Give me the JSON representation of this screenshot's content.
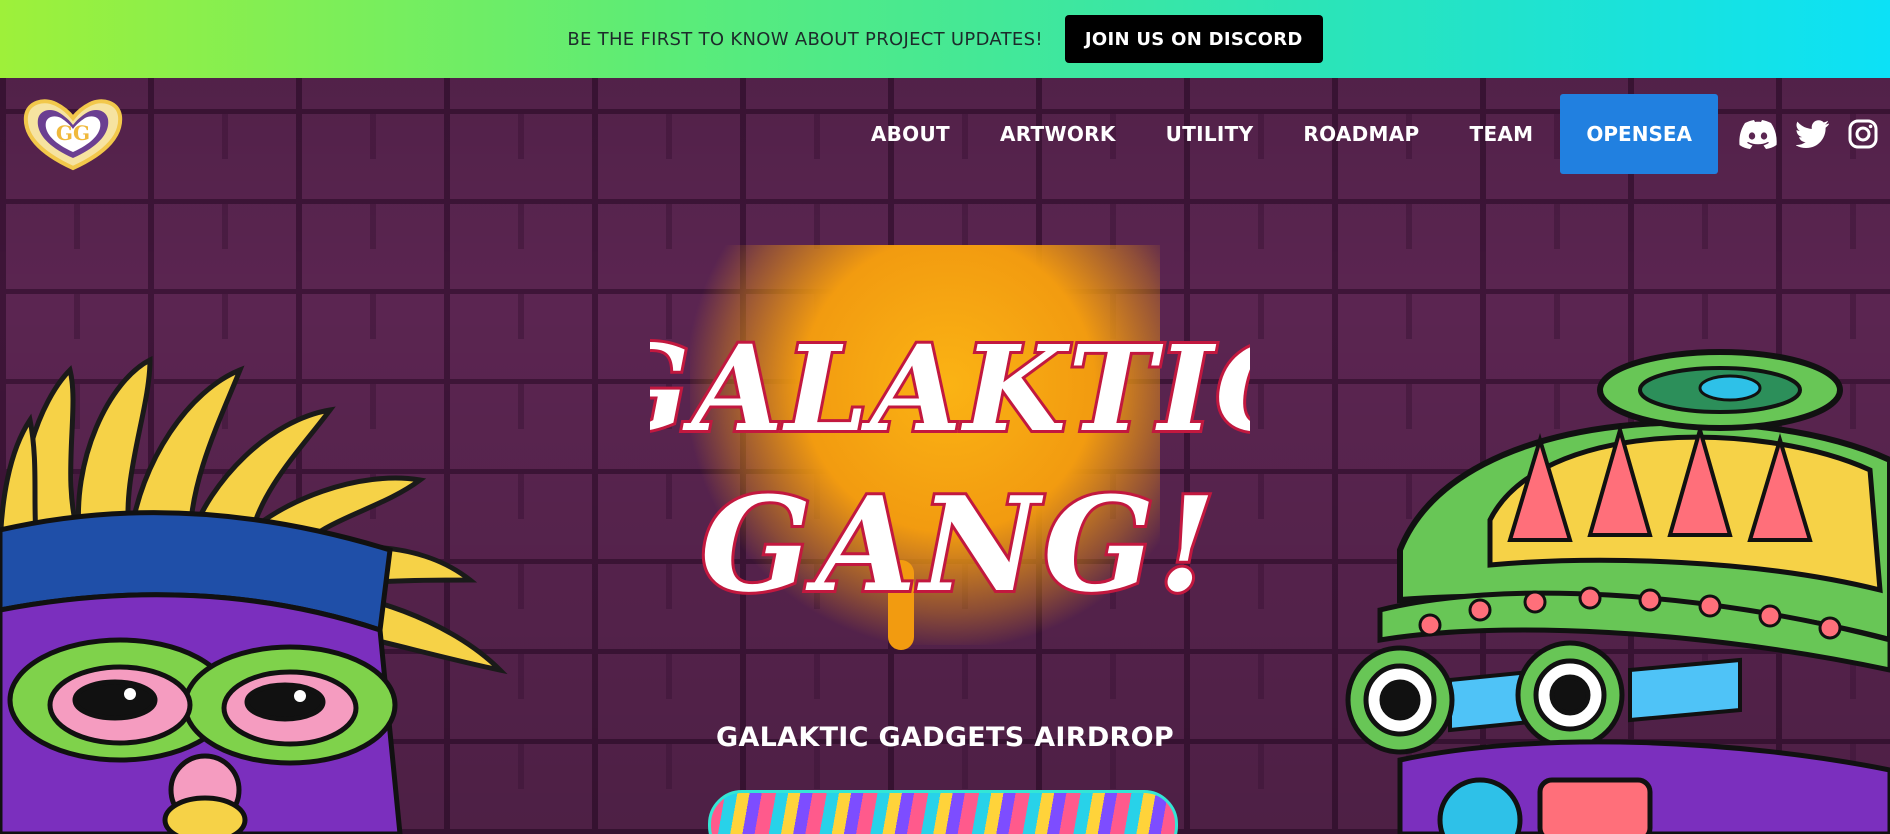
{
  "announcement": {
    "text": "BE THE FIRST TO KNOW ABOUT PROJECT UPDATES!",
    "button_label": "JOIN US ON DISCORD"
  },
  "nav": {
    "items": [
      {
        "label": "ABOUT"
      },
      {
        "label": "ARTWORK"
      },
      {
        "label": "UTILITY"
      },
      {
        "label": "ROADMAP"
      },
      {
        "label": "TEAM"
      }
    ],
    "cta_label": "OPENSEA",
    "social": [
      "discord-icon",
      "twitter-icon",
      "instagram-icon"
    ]
  },
  "hero": {
    "wordmark": "GALAKTIC GANG!",
    "subtitle": "GALAKTIC GADGETS AIRDROP"
  },
  "colors": {
    "wall": "#5b2551",
    "opensea": "#2180e0",
    "splash": "#f29b10"
  }
}
